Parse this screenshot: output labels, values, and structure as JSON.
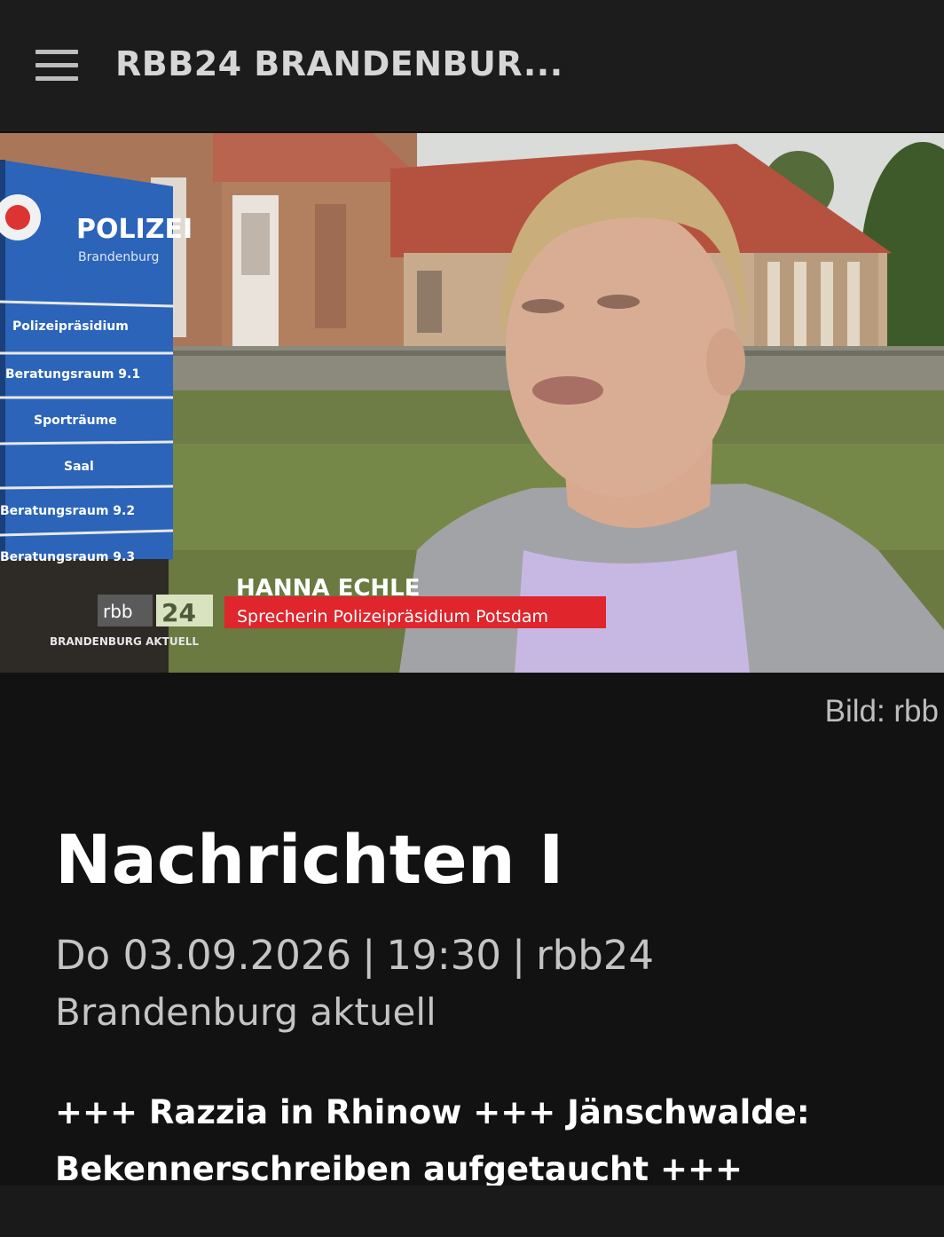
{
  "header": {
    "menu_icon": "hamburger-menu-icon",
    "title": "RBB24 BRANDENBUR..."
  },
  "video": {
    "sign": {
      "header": "POLIZEI",
      "subheader": "Brandenburg",
      "rows": [
        "Polizeipräsidium",
        "Beratungsraum 9.1",
        "Sporträume",
        "Saal",
        "Beratungsraum 9.2",
        "Beratungsraum 9.3"
      ]
    },
    "lower_third": {
      "name": "HANNA ECHLE",
      "role": "Sprecherin Polizeipräsidium Potsdam"
    },
    "channel_logo": {
      "brand": "rbb",
      "number": "24",
      "program": "BRANDENBURG AKTUELL"
    }
  },
  "image_credit": "Bild: rbb",
  "article": {
    "title": "Nachrichten I",
    "meta": {
      "date": "Do 03.09.2026",
      "time": "19:30",
      "channel": "rbb24",
      "separator": "|"
    },
    "program": "Brandenburg aktuell",
    "teaser_line1": "+++ Razzia in Rhinow +++ Jänschwalde:",
    "teaser_line2": "Bekennerschreiben aufgetaucht +++"
  },
  "colors": {
    "background": "#121212",
    "topbar": "#1c1c1c",
    "sign_blue": "#2b64b8",
    "lower_third_red": "#e0252c"
  }
}
